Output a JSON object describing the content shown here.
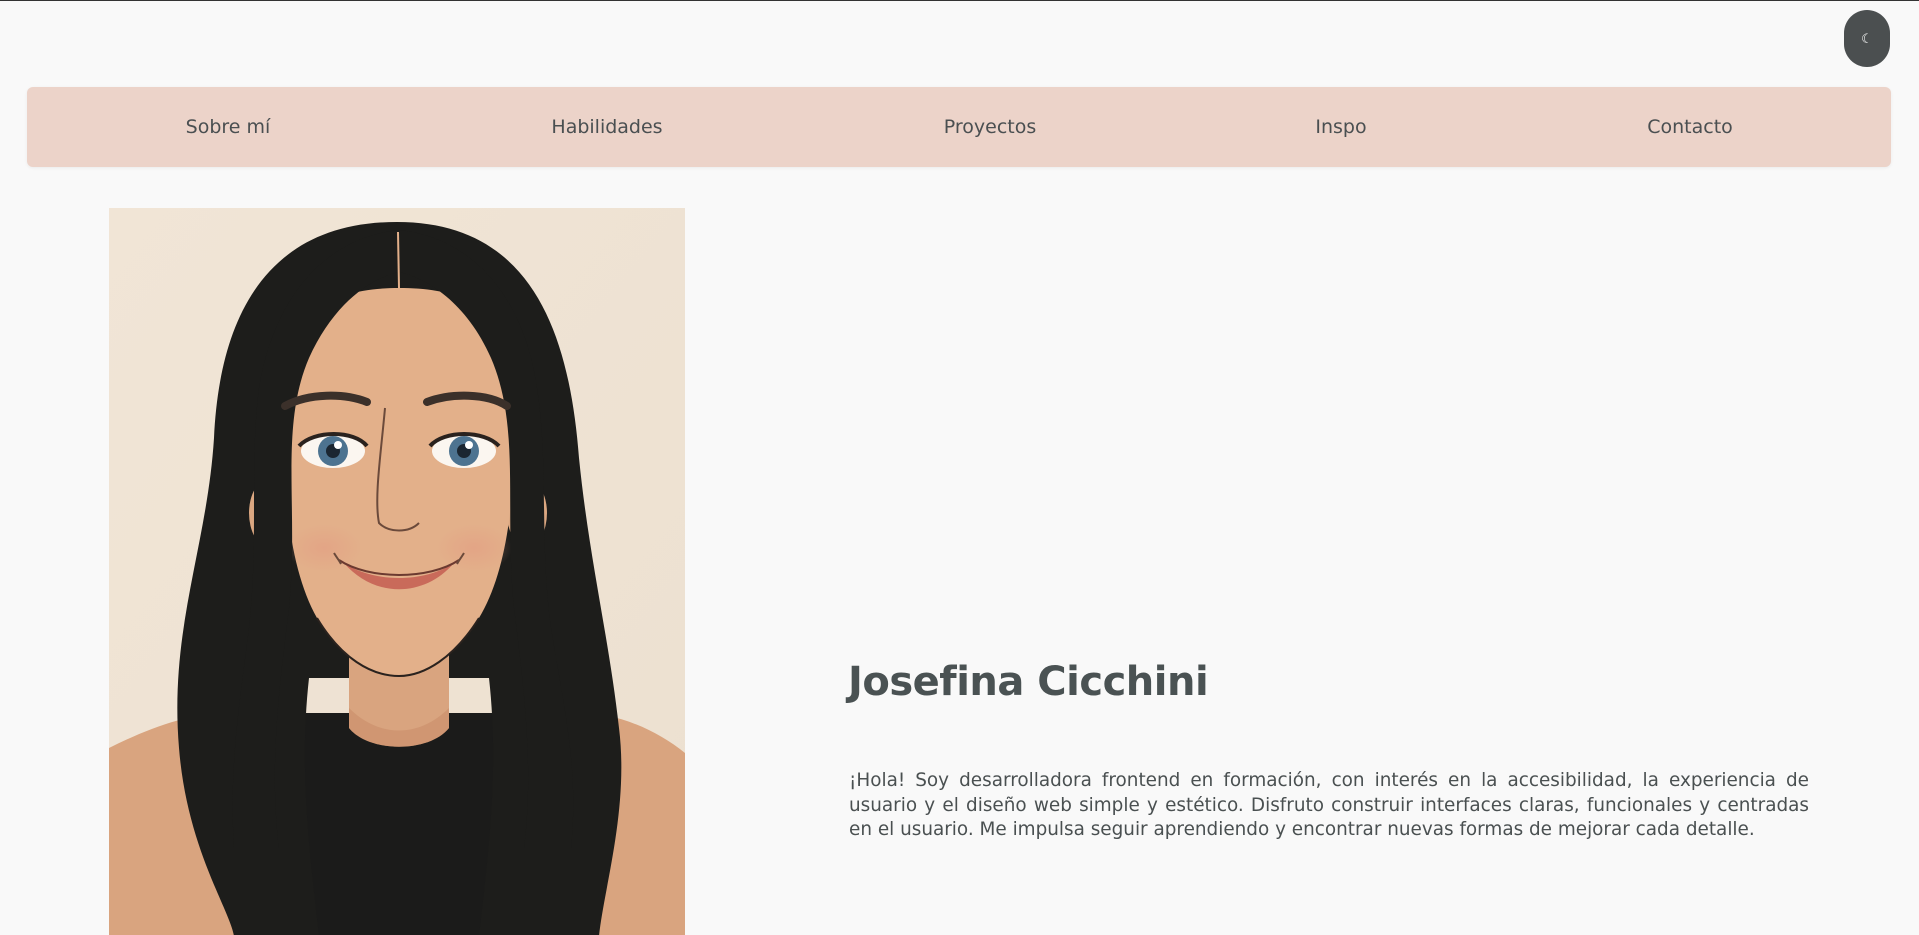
{
  "theme_toggle": {
    "icon": "moon-icon",
    "glyph": "☾"
  },
  "nav": {
    "items": [
      {
        "label": "Sobre mí"
      },
      {
        "label": "Habilidades"
      },
      {
        "label": "Proyectos"
      },
      {
        "label": "Inspo"
      },
      {
        "label": "Contacto"
      }
    ]
  },
  "profile": {
    "name": "Josefina Cicchini",
    "bio": "¡Hola! Soy desarrolladora frontend en formación, con interés en la accesibilidad, la experiencia de usuario y el diseño web simple y estético. Disfruto construir interfaces claras, funcionales y centradas en el usuario. Me impulsa seguir aprendiendo y encontrar nuevas formas de mejorar cada detalle."
  },
  "colors": {
    "background": "#f9f9f9",
    "nav_background": "#ecd3c9",
    "text": "#4a5051",
    "toggle_background": "#4b4f50"
  }
}
